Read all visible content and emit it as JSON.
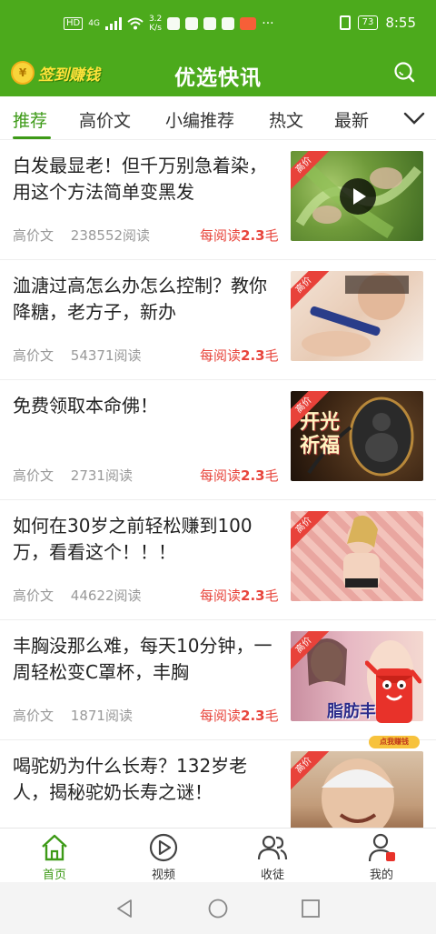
{
  "status_bar": {
    "hd": "HD",
    "network": "4G",
    "speed_value": "3.2",
    "speed_unit": "K/s",
    "overflow": "···",
    "battery": "73",
    "time": "8:55"
  },
  "header": {
    "signin_label": "签到赚钱",
    "title": "优选快讯",
    "coin_symbol": "¥"
  },
  "tabs": [
    {
      "label": "推荐",
      "active": true
    },
    {
      "label": "高价文",
      "active": false
    },
    {
      "label": "小编推荐",
      "active": false
    },
    {
      "label": "热文",
      "active": false
    },
    {
      "label": "最新",
      "active": false
    }
  ],
  "articles": [
    {
      "title": "白发最显老！但千万别急着染，用这个方法简单变黑发",
      "category": "高价文",
      "reads": "238552阅读",
      "reward_prefix": "每阅读",
      "reward_value": "2.3",
      "reward_unit": "毛",
      "ribbon": "高价",
      "has_video": true
    },
    {
      "title": "洫溏过高怎么办怎么控制？教你降糖，老方子，新办",
      "category": "高价文",
      "reads": "54371阅读",
      "reward_prefix": "每阅读",
      "reward_value": "2.3",
      "reward_unit": "毛",
      "ribbon": "高价",
      "has_video": false
    },
    {
      "title": "免费领取本命佛！",
      "category": "高价文",
      "reads": "2731阅读",
      "reward_prefix": "每阅读",
      "reward_value": "2.3",
      "reward_unit": "毛",
      "ribbon": "高价",
      "has_video": false,
      "image_text": "开光祈福"
    },
    {
      "title": "如何在30岁之前轻松赚到100万，看看这个！！！",
      "category": "高价文",
      "reads": "44622阅读",
      "reward_prefix": "每阅读",
      "reward_value": "2.3",
      "reward_unit": "毛",
      "ribbon": "高价",
      "has_video": false
    },
    {
      "title": "丰胸没那么难，每天10分钟，一周轻松变C罩杯，丰胸",
      "category": "高价文",
      "reads": "1871阅读",
      "reward_prefix": "每阅读",
      "reward_value": "2.3",
      "reward_unit": "毛",
      "ribbon": "高价",
      "has_video": false,
      "image_text": "脂肪丰"
    },
    {
      "title": "喝驼奶为什么长寿？132岁老人，揭秘驼奶长寿之谜！",
      "category": "高价文",
      "reads": "",
      "reward_prefix": "",
      "reward_value": "",
      "reward_unit": "",
      "ribbon": "高价",
      "has_video": false
    }
  ],
  "float_button": {
    "label": "点我赚钱"
  },
  "bottom_nav": [
    {
      "label": "首页",
      "icon": "home-icon",
      "active": true
    },
    {
      "label": "视频",
      "icon": "video-icon",
      "active": false
    },
    {
      "label": "收徒",
      "icon": "users-icon",
      "active": false
    },
    {
      "label": "我的",
      "icon": "profile-icon",
      "active": false
    }
  ],
  "colors": {
    "brand_green": "#4caa1c",
    "active_green": "#3d9a17",
    "reward_red": "#e8453c",
    "signin_yellow": "#ffe33a"
  }
}
